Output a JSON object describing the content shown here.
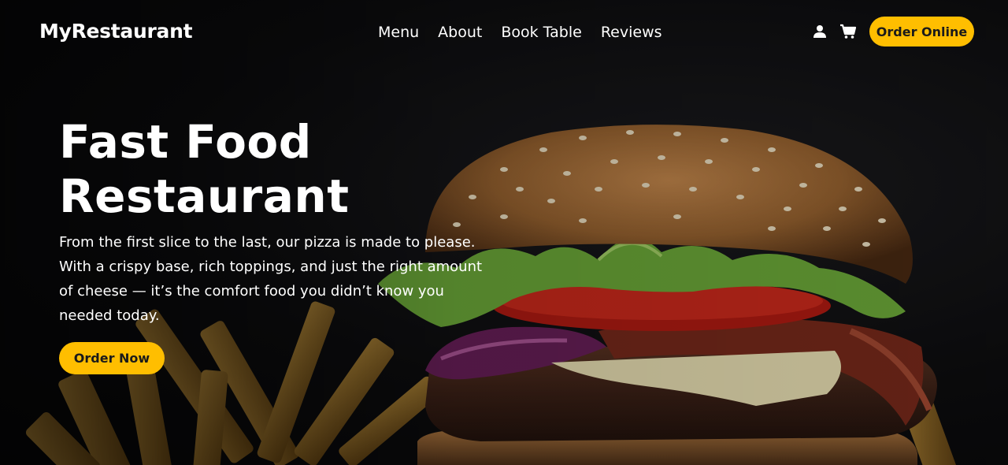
{
  "brand": {
    "name": "MyRestaurant"
  },
  "nav": {
    "links": [
      {
        "label": "Menu"
      },
      {
        "label": "About"
      },
      {
        "label": "Book Table"
      },
      {
        "label": "Reviews"
      }
    ],
    "icons": {
      "user": "user-icon",
      "cart": "shopping-cart-icon"
    },
    "order_online_label": "Order Online"
  },
  "hero": {
    "title_line1": "Fast Food",
    "title_line2": "Restaurant",
    "description": "From the first slice to the last, our pizza is made to please. With a crispy base, rich toppings, and just the right amount of cheese — it’s the comfort food you didn’t know you needed today.",
    "order_now_label": "Order Now"
  },
  "colors": {
    "accent": "#ffbe00",
    "background": "#0b0b0c",
    "text": "#ffffff"
  }
}
